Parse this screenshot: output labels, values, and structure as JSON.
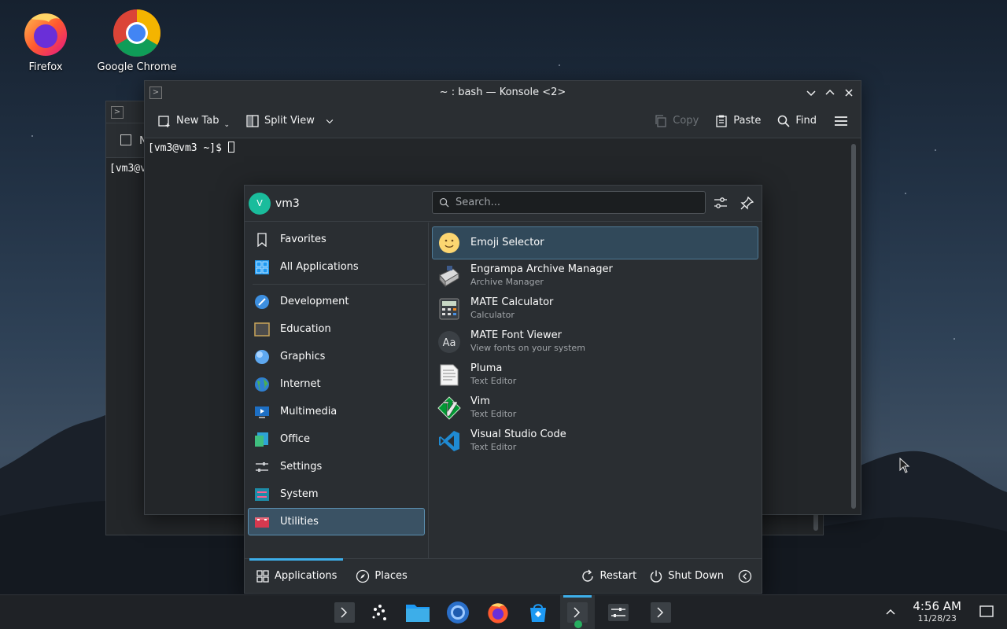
{
  "desktop": {
    "icons": [
      {
        "label": "Firefox",
        "icon": "firefox-icon"
      },
      {
        "label": "Google Chrome",
        "icon": "chrome-icon"
      }
    ]
  },
  "back_window": {
    "toolbar_partial": "N",
    "prompt_partial": "[vm3@v"
  },
  "konsole": {
    "title": "~ : bash — Konsole <2>",
    "toolbar": {
      "new_tab": "New Tab",
      "split_view": "Split View",
      "copy": "Copy",
      "paste": "Paste",
      "find": "Find"
    },
    "prompt": "[vm3@vm3 ~]$ "
  },
  "launcher": {
    "avatar_letter": "V",
    "username": "vm3",
    "search_placeholder": "Search...",
    "categories": [
      {
        "label": "Favorites",
        "icon": "bookmark-icon"
      },
      {
        "label": "All Applications",
        "icon": "grid-icon"
      },
      {
        "label": "Development",
        "icon": "development-icon"
      },
      {
        "label": "Education",
        "icon": "education-icon"
      },
      {
        "label": "Graphics",
        "icon": "graphics-icon"
      },
      {
        "label": "Internet",
        "icon": "globe-icon"
      },
      {
        "label": "Multimedia",
        "icon": "multimedia-icon"
      },
      {
        "label": "Office",
        "icon": "office-icon"
      },
      {
        "label": "Settings",
        "icon": "settings-icon"
      },
      {
        "label": "System",
        "icon": "system-icon"
      },
      {
        "label": "Utilities",
        "icon": "utilities-icon",
        "active": true
      }
    ],
    "apps": [
      {
        "name": "Emoji Selector",
        "desc": "",
        "icon": "emoji-icon",
        "active": true
      },
      {
        "name": "Engrampa Archive Manager",
        "desc": "Archive Manager",
        "icon": "archive-icon"
      },
      {
        "name": "MATE Calculator",
        "desc": "Calculator",
        "icon": "calculator-icon"
      },
      {
        "name": "MATE Font Viewer",
        "desc": "View fonts on your system",
        "icon": "font-icon"
      },
      {
        "name": "Pluma",
        "desc": "Text Editor",
        "icon": "text-editor-icon"
      },
      {
        "name": "Vim",
        "desc": "Text Editor",
        "icon": "vim-icon"
      },
      {
        "name": "Visual Studio Code",
        "desc": "Text Editor",
        "icon": "vscode-icon"
      }
    ],
    "footer": {
      "applications": "Applications",
      "places": "Places",
      "restart": "Restart",
      "shutdown": "Shut Down"
    }
  },
  "taskbar": {
    "time": "4:56 AM",
    "date": "11/28/23"
  },
  "colors": {
    "accent": "#3daee9",
    "panel": "#2a2e32",
    "window": "#232629"
  }
}
